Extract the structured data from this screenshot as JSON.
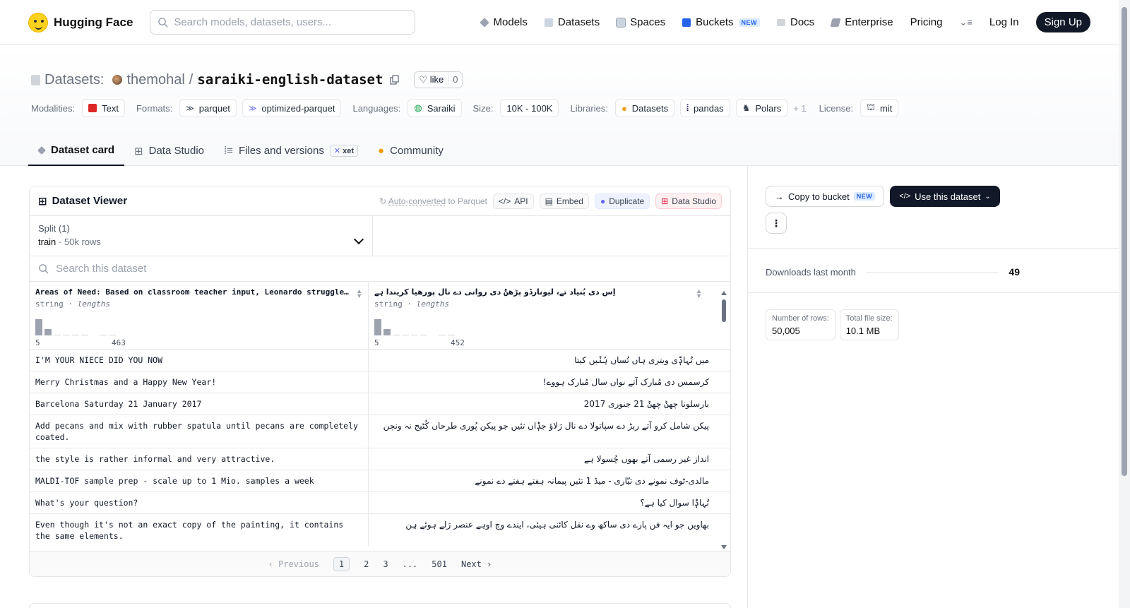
{
  "nav": {
    "brand": "Hugging Face",
    "search_placeholder": "Search models, datasets, users...",
    "links": [
      {
        "label": "Models",
        "icon": "models-icon",
        "color": "#9ca3af"
      },
      {
        "label": "Datasets",
        "icon": "datasets-icon",
        "color": "#9ca3af"
      },
      {
        "label": "Spaces",
        "icon": "spaces-icon",
        "color": "#9ca3af"
      },
      {
        "label": "Buckets",
        "icon": "buckets-icon",
        "color": "#2563eb",
        "badge": "NEW"
      },
      {
        "label": "Docs",
        "icon": "docs-icon",
        "color": "#9ca3af"
      },
      {
        "label": "Enterprise",
        "icon": "enterprise-icon",
        "color": "#9ca3af"
      },
      {
        "label": "Pricing"
      }
    ],
    "login": "Log In",
    "signup": "Sign Up"
  },
  "header": {
    "prefix": "Datasets:",
    "owner": "themohal",
    "separator": "/",
    "name": "saraiki-english-dataset",
    "like_label": "like",
    "like_count": "0"
  },
  "tags": {
    "modalities_label": "Modalities:",
    "modality": "Text",
    "formats_label": "Formats:",
    "format1": "parquet",
    "format2": "optimized-parquet",
    "languages_label": "Languages:",
    "language": "Saraiki",
    "size_label": "Size:",
    "size": "10K - 100K",
    "libraries_label": "Libraries:",
    "lib1": "Datasets",
    "lib2": "pandas",
    "lib3": "Polars",
    "more": "+ 1",
    "license_label": "License:",
    "license": "mit"
  },
  "tabs": {
    "card": "Dataset card",
    "studio": "Data Studio",
    "files": "Files and versions",
    "xet": "xet",
    "community": "Community"
  },
  "viewer": {
    "title": "Dataset Viewer",
    "auto_link": "Auto-converted",
    "auto_rest": " to Parquet",
    "api": "API",
    "embed": "Embed",
    "duplicate": "Duplicate",
    "data_studio": "Data Studio",
    "split_label": "Split (1)",
    "split_name": "train",
    "split_dot": "·",
    "split_rows": "50k rows",
    "search_placeholder": "Search this dataset",
    "columns": [
      {
        "name": "Areas of Need: Based on classroom teacher input, Leonardo struggles with reading",
        "type": "string",
        "sub": "lengths",
        "min": "5",
        "max": "463",
        "hist": [
          0.9,
          0.35,
          0.05,
          0.05,
          0.05,
          0.05,
          0,
          0.05,
          0.05
        ]
      },
      {
        "name": "اِس دی بُنیاد تے، لیونارڈو پڑھݨ دی روانی دے نال پورھیا کریندا ہے",
        "type": "string",
        "sub": "lengths",
        "min": "5",
        "max": "452",
        "hist": [
          0.9,
          0.35,
          0.05,
          0.05,
          0.05,
          0.05,
          0,
          0.05,
          0.05
        ]
      }
    ],
    "rows": [
      [
        "I'M YOUR NIECE DID YOU NOW",
        "میں تُہاݙی ویتری ہاں تُساں ہُݨیں کیتا"
      ],
      [
        "Merry Christmas and a Happy New Year!",
        "کرسمس دی مُبارک آتے نواں سال مُبارک ہووے!"
      ],
      [
        "Barcelona Saturday 21 January 2017",
        "بارسلونا چھݨ چھݨ 21 جنوری 2017"
      ],
      [
        "Add pecans and mix with rubber spatula until pecans are completely coated.",
        "پیکن شامل کرو آتے ربڑ دے سپاتولا دے نال رَلاؤ جݙاں تئیں جو پیکن پُوری طرحاں کُٹیج نہ ونڄن"
      ],
      [
        "the style is rather informal and very attractive.",
        "انداز غیر رسمی آتے بھوں چُسولا ہے"
      ],
      [
        "MALDI-TOF sample prep - scale up to 1 Mio. samples a week",
        "مالدی-ٹوف نمونے دی تیّاری - میڈ 1 تئیں پیمانہ ہفتے ہفتے دے نمونے"
      ],
      [
        "What's your question?",
        "تُہاݙا سوال کیا ہے؟"
      ],
      [
        "Even though it's not an exact copy of the painting, it contains the same elements.",
        "بھاویں جو ایہ فن پارے دی ساکھ وے نقل کائنی ہیئی، ایندے وچ اوہے عنصر رَلے ہوئے ہِن"
      ]
    ],
    "pager": {
      "prev": "‹ Previous",
      "p1": "1",
      "p2": "2",
      "p3": "3",
      "ellipsis": "...",
      "last": "501",
      "next": "Next ›"
    }
  },
  "sidebar": {
    "copy_bucket": "Copy to bucket",
    "new_badge": "NEW",
    "use_dataset": "Use this dataset",
    "downloads_label": "Downloads last month",
    "downloads": "49",
    "rows_label": "Number of rows:",
    "rows_value": "50,005",
    "size_label": "Total file size:",
    "size_value": "10.1 MB"
  }
}
